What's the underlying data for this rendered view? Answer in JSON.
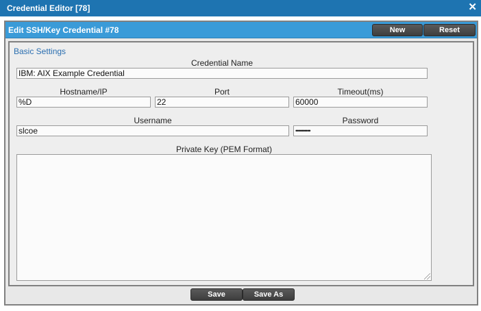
{
  "window": {
    "title": "Credential Editor [78]",
    "close_glyph": "✕"
  },
  "header": {
    "title": "Edit SSH/Key Credential #78",
    "new_label": "New",
    "reset_label": "Reset"
  },
  "section": {
    "title": "Basic Settings"
  },
  "fields": {
    "credential_name": {
      "label": "Credential Name",
      "value": "IBM: AIX Example Credential"
    },
    "hostname": {
      "label": "Hostname/IP",
      "value": "%D"
    },
    "port": {
      "label": "Port",
      "value": "22"
    },
    "timeout": {
      "label": "Timeout(ms)",
      "value": "60000"
    },
    "username": {
      "label": "Username",
      "value": "slcoe"
    },
    "password": {
      "label": "Password",
      "value": "••••••••••"
    },
    "private_key": {
      "label": "Private Key (PEM Format)",
      "value": ""
    }
  },
  "footer": {
    "save_label": "Save",
    "save_as_label": "Save As"
  }
}
